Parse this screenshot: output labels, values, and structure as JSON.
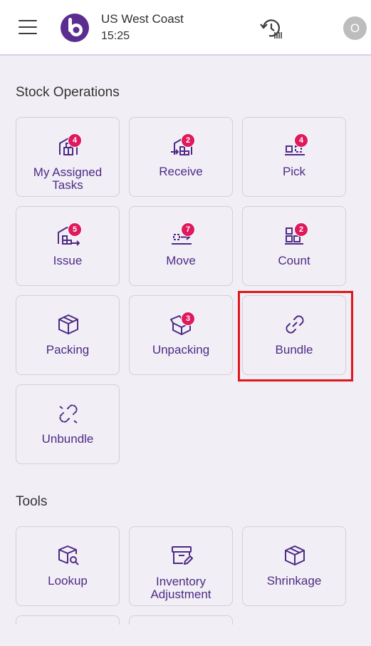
{
  "header": {
    "location": "US West Coast",
    "time": "15:25",
    "avatar_initial": "O"
  },
  "stock_operations": {
    "title": "Stock Operations",
    "tiles": [
      {
        "label": "My Assigned Tasks",
        "badge": "4",
        "icon": "warehouse-icon"
      },
      {
        "label": "Receive",
        "badge": "2",
        "icon": "receive-icon"
      },
      {
        "label": "Pick",
        "badge": "4",
        "icon": "pick-icon"
      },
      {
        "label": "Issue",
        "badge": "5",
        "icon": "issue-icon"
      },
      {
        "label": "Move",
        "badge": "7",
        "icon": "move-icon"
      },
      {
        "label": "Count",
        "badge": "2",
        "icon": "count-icon"
      },
      {
        "label": "Packing",
        "icon": "box-icon"
      },
      {
        "label": "Unpacking",
        "badge": "3",
        "icon": "open-box-icon"
      },
      {
        "label": "Bundle",
        "icon": "link-icon"
      },
      {
        "label": "Unbundle",
        "icon": "unlink-icon"
      }
    ]
  },
  "tools": {
    "title": "Tools",
    "tiles": [
      {
        "label": "Lookup",
        "icon": "box-search-icon"
      },
      {
        "label": "Inventory Adjustment",
        "icon": "box-edit-icon"
      },
      {
        "label": "Shrinkage",
        "icon": "box-shrink-icon"
      }
    ]
  },
  "colors": {
    "accent": "#4e2a86",
    "badge": "#e0185c",
    "highlight": "#e0171c"
  }
}
